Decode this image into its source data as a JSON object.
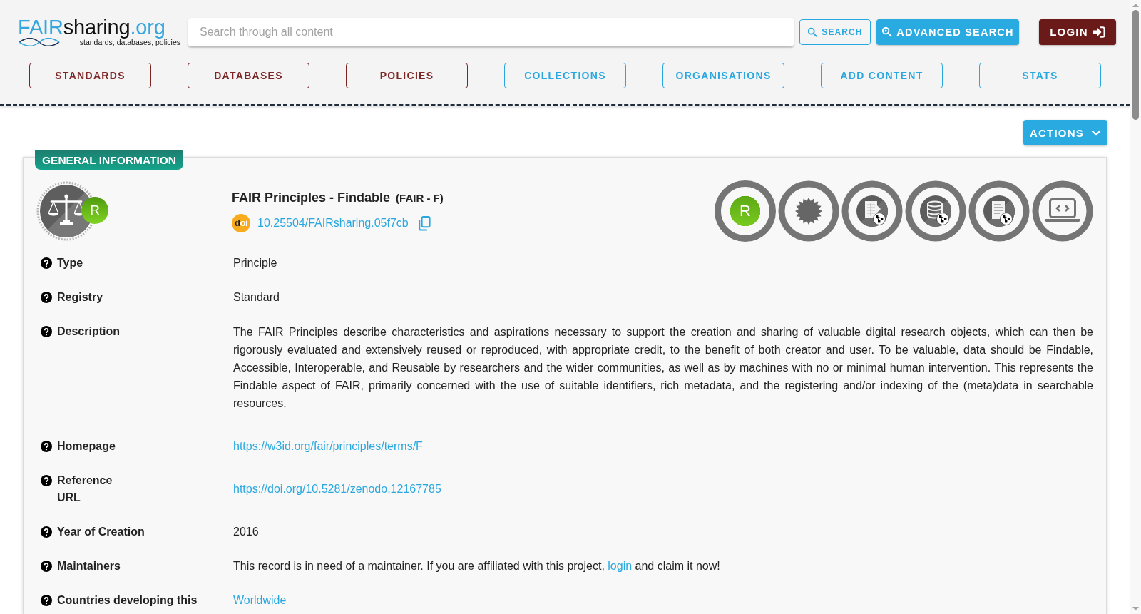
{
  "logo": {
    "wordmark": [
      {
        "text": "FAIR",
        "color": "#35a7de"
      },
      {
        "text": "sharing",
        "color": "#111111"
      },
      {
        "text": ".org",
        "color": "#35a7de"
      }
    ],
    "tagline": "standards, databases, policies"
  },
  "search": {
    "placeholder": "Search through all content"
  },
  "search_button": {
    "label": "SEARCH"
  },
  "advanced_search_button": {
    "label": "ADVANCED SEARCH"
  },
  "login_button": {
    "label": "LOGIN"
  },
  "nav": [
    {
      "label": "STANDARDS",
      "color": "#7b2525"
    },
    {
      "label": "DATABASES",
      "color": "#7b2525"
    },
    {
      "label": "POLICIES",
      "color": "#7b2525"
    },
    {
      "label": "COLLECTIONS",
      "color": "#29a8e0"
    },
    {
      "label": "ORGANISATIONS",
      "color": "#29a8e0"
    },
    {
      "label": "ADD CONTENT",
      "color": "#29a8e0"
    },
    {
      "label": "STATS",
      "color": "#29a8e0"
    }
  ],
  "actions_button": {
    "label": "ACTIONS"
  },
  "section_tab": "GENERAL INFORMATION",
  "record": {
    "logo_badge": "R",
    "title": "FAIR Principles - Findable",
    "abbreviation": "(FAIR - F)",
    "doi_logo": [
      {
        "text": "d",
        "color": "#231f20"
      },
      {
        "text": "oi",
        "color": "#ffffff"
      }
    ],
    "doi": "10.25504/FAIRsharing.05f7cb",
    "ring_letter": "R"
  },
  "fields": [
    {
      "label": "Type",
      "kind": "text",
      "value": "Principle"
    },
    {
      "label": "Registry",
      "kind": "text",
      "value": "Standard"
    },
    {
      "label": "Description",
      "kind": "paragraph",
      "value": "The FAIR Principles describe characteristics and aspirations necessary to support the creation and sharing of valuable digital research objects, which can then be rigorously evaluated and extensively reused or reproduced, with appropriate credit, to the benefit of both creator and user. To be valuable, data should be Findable, Accessible, Interoperable, and Reusable by researchers and the wider communities, as well as by machines with no or minimal human intervention. This represents the Findable aspect of FAIR, primarily concerned with the use of suitable identifiers, rich metadata, and the registering and/or indexing of the (meta)data in searchable resources."
    },
    {
      "label": "Homepage",
      "kind": "link",
      "value": "https://w3id.org/fair/principles/terms/F"
    },
    {
      "label": "Reference\nURL",
      "kind": "link",
      "value": "https://doi.org/10.5281/zenodo.12167785"
    },
    {
      "label": "Year of Creation",
      "kind": "text",
      "value": "2016"
    },
    {
      "label": "Maintainers",
      "kind": "sentence",
      "before": "This record is in need of a maintainer. If you are affiliated with this project,",
      "link": "login",
      "after": "and claim it now!"
    },
    {
      "label": "Countries developing this",
      "kind": "link",
      "value": "Worldwide"
    }
  ]
}
